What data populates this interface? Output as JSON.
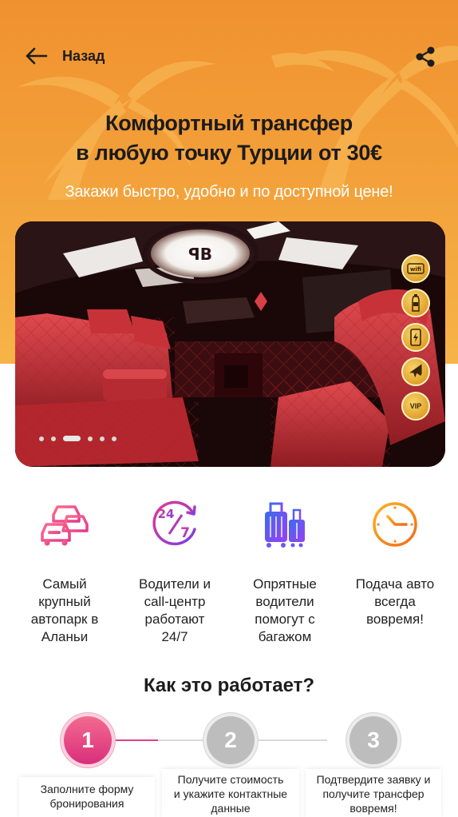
{
  "header": {
    "back_label": "Назад",
    "title_line1": "Комфортный трансфер",
    "title_line2": "в любую точку Турции от 30€",
    "subtitle": "Закажи быстро, удобно и по доступной цене!"
  },
  "gallery": {
    "slide_count": 6,
    "active_slide": 3,
    "badges": [
      {
        "icon": "wifi-icon",
        "label": "wifi"
      },
      {
        "icon": "water-bottle-icon",
        "label": ""
      },
      {
        "icon": "phone-charger-icon",
        "label": ""
      },
      {
        "icon": "airplane-icon",
        "label": ""
      },
      {
        "icon": "vip-icon",
        "label": "VIP"
      }
    ]
  },
  "features": [
    {
      "icon": "cars-icon",
      "text_lines": [
        "Самый",
        "крупный",
        "автопарк в",
        "Аланьи"
      ]
    },
    {
      "icon": "clock-24-7-icon",
      "text_lines": [
        "Водители и",
        "call-центр",
        "работают",
        "24/7"
      ]
    },
    {
      "icon": "luggage-icon",
      "text_lines": [
        "Опрятные",
        "водители",
        "помогут с",
        "багажом"
      ]
    },
    {
      "icon": "clock-icon",
      "text_lines": [
        "Подача авто",
        "всегда",
        "вовремя!"
      ]
    }
  ],
  "how_it_works": {
    "title": "Как это работает?",
    "steps": [
      {
        "number": "1",
        "text_lines": [
          "Заполните форму",
          "бронирования"
        ],
        "active": true
      },
      {
        "number": "2",
        "text_lines": [
          "Получите стоимость",
          "и укажите контактные",
          "данные"
        ],
        "active": false
      },
      {
        "number": "3",
        "text_lines": [
          "Подтвердите заявку и",
          "получите трансфер",
          "вовремя!"
        ],
        "active": false
      }
    ]
  },
  "colors": {
    "hero_orange": "#f0912f",
    "accent_pink": "#e2408b",
    "badge_gold": "#e2a22a"
  }
}
